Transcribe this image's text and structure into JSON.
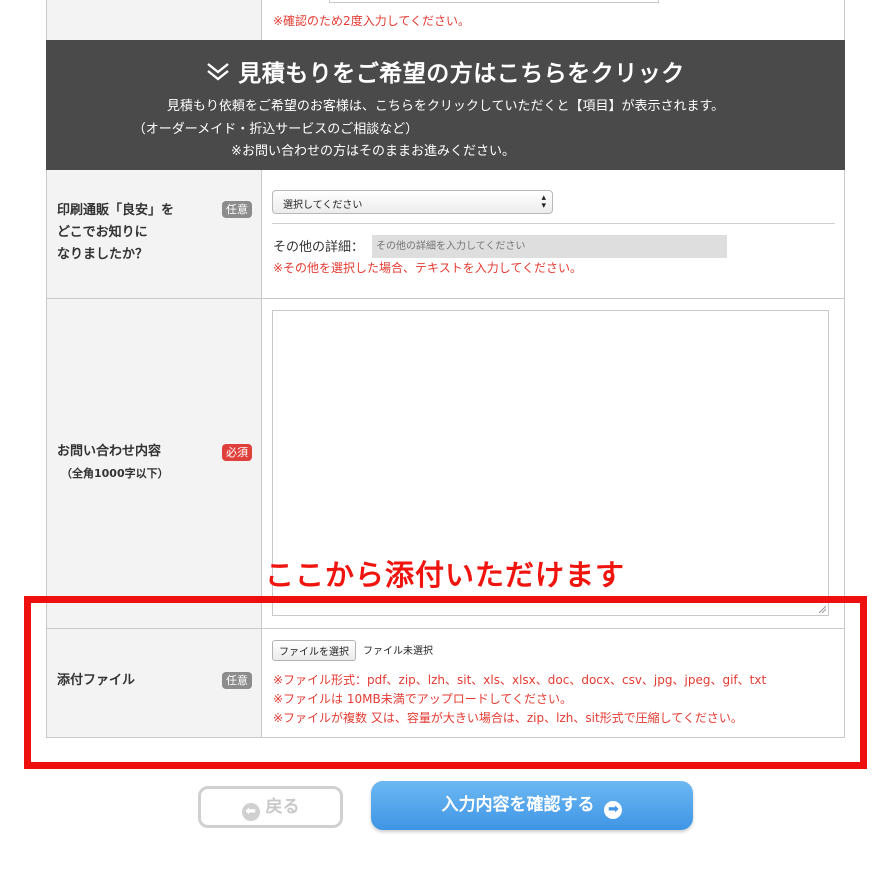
{
  "top": {
    "note": "※確認のため2度入力してください。"
  },
  "banner": {
    "icon": "double-chevron-down-icon",
    "title": "見積もりをご希望の方はこちらをクリック",
    "lines": [
      "見積もり依頼をご希望のお客様は、こちらをクリックしていただくと【項目】が表示されます。",
      "（オーダーメイド・折込サービスのご相談など）",
      "※お問い合わせの方はそのままお進みください。"
    ]
  },
  "source": {
    "label_lines": [
      "印刷通販「良安」を",
      "どこでお知りに",
      "なりましたか？"
    ],
    "badge": "任意",
    "select_value": "選択してください",
    "other_label": "その他の詳細：",
    "other_placeholder": "その他の詳細を入力してください",
    "note": "※その他を選択した場合、テキストを入力してください。"
  },
  "inquiry": {
    "label": "お問い合わせ内容",
    "sublabel": "（全角1000字以下）",
    "badge": "必須"
  },
  "annotation": "ここから添付いただけます",
  "attach": {
    "label": "添付ファイル",
    "badge": "任意",
    "button": "ファイルを選択",
    "status": "ファイル未選択",
    "notes": [
      "※ファイル形式：pdf、zip、lzh、sit、xls、xlsx、doc、docx、csv、jpg、jpeg、gif、txt",
      "※ファイルは 10MB未満でアップロードしてください。",
      "※ファイルが複数 又は、容量が大きい場合は、zip、lzh、sit形式で圧縮してください。"
    ]
  },
  "buttons": {
    "back": "戻る",
    "submit": "入力内容を確認する"
  },
  "colors": {
    "banner": "#4a4a4a",
    "required_badge": "#e0403b",
    "optional_badge": "#8c8c8c",
    "note_red": "#e53b32",
    "annotation_red": "#ee0f0f",
    "submit_blue": "#3f95e5"
  }
}
